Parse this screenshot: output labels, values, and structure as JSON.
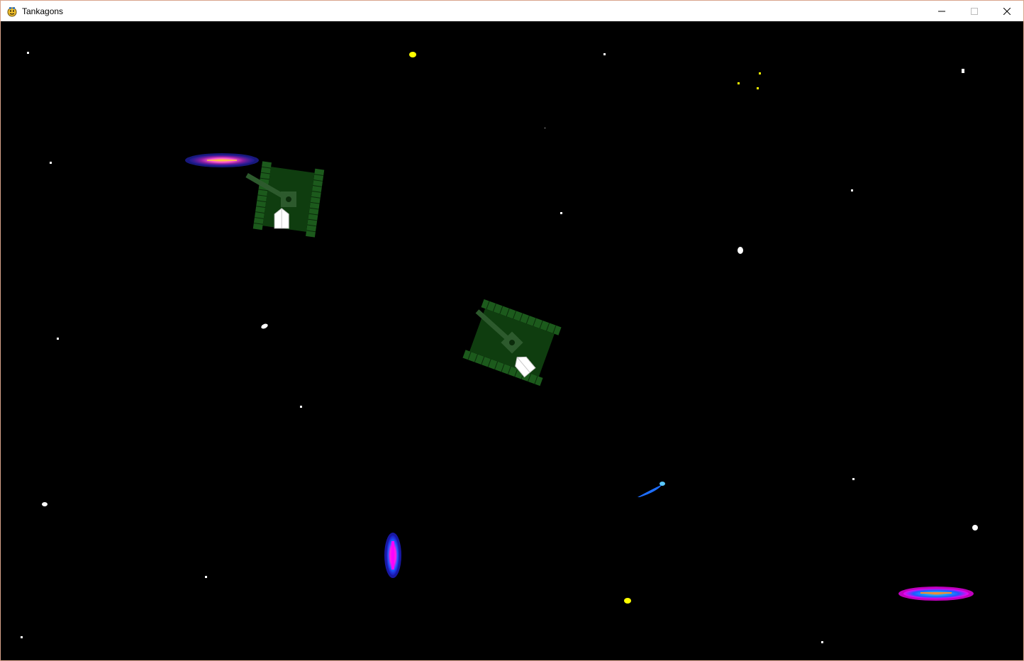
{
  "window": {
    "title": "Tankagons",
    "icons": {
      "app": "pygame-snake-icon",
      "minimize": "minimize-icon",
      "maximize": "maximize-icon",
      "close": "close-icon"
    }
  },
  "game": {
    "background_color": "#000000",
    "colors": {
      "star_white": "#ffffff",
      "star_yellow": "#ffff00",
      "tank_body": "#0f3d0f",
      "tank_track": "#1c5a1c",
      "tank_barrel": "#2d5a2d",
      "shield": "#ffffff",
      "nebula_magenta": "#ff00ff",
      "nebula_blue": "#1e5aff",
      "nebula_orange": "#ff8c28",
      "comet_blue": "#1e6eff"
    },
    "objects": {
      "player_tanks": 2,
      "nebulae": 3,
      "comets": 1
    }
  }
}
